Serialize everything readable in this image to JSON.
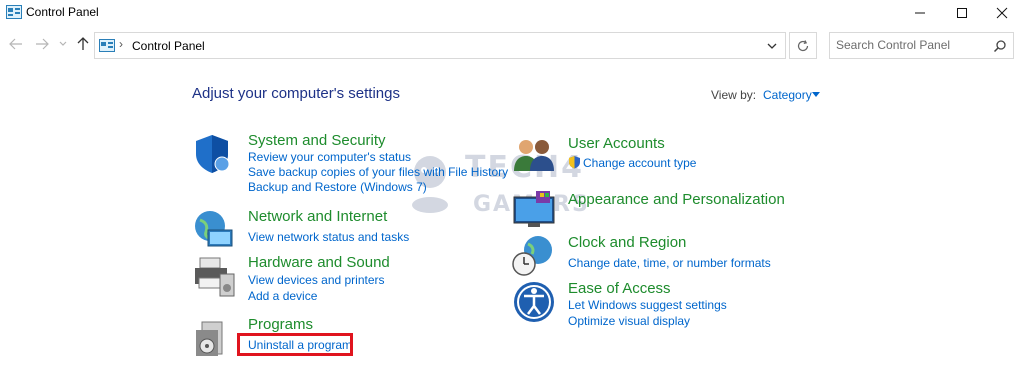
{
  "window": {
    "title": "Control Panel",
    "controls": {
      "minimize": "minimize-icon",
      "maximize": "maximize-icon",
      "close": "close-icon"
    }
  },
  "nav": {
    "back": "back-arrow-icon",
    "forward": "forward-arrow-icon",
    "recent": "chevron-down-icon",
    "up": "up-arrow-icon",
    "address": {
      "separator": "›",
      "location": "Control Panel"
    },
    "refresh": "refresh-icon",
    "search": {
      "placeholder": "Search Control Panel",
      "value": ""
    }
  },
  "content": {
    "heading": "Adjust your computer's settings",
    "view_by": {
      "label": "View by:",
      "value": "Category"
    },
    "categories_left": [
      {
        "title": "System and Security",
        "icon": "shield-icon",
        "links": [
          "Review your computer's status",
          "Save backup copies of your files with File History",
          "Backup and Restore (Windows 7)"
        ]
      },
      {
        "title": "Network and Internet",
        "icon": "network-globe-icon",
        "links": [
          "View network status and tasks"
        ]
      },
      {
        "title": "Hardware and Sound",
        "icon": "printer-icon",
        "links": [
          "View devices and printers",
          "Add a device"
        ]
      },
      {
        "title": "Programs",
        "icon": "programs-icon",
        "links": [
          "Uninstall a program"
        ]
      }
    ],
    "categories_right": [
      {
        "title": "User Accounts",
        "icon": "users-icon",
        "links": [
          "Change account type"
        ]
      },
      {
        "title": "Appearance and Personalization",
        "icon": "display-icon",
        "links": []
      },
      {
        "title": "Clock and Region",
        "icon": "clock-globe-icon",
        "links": [
          "Change date, time, or number formats"
        ]
      },
      {
        "title": "Ease of Access",
        "icon": "ease-of-access-icon",
        "links": [
          "Let Windows suggest settings",
          "Optimize visual display"
        ]
      }
    ]
  },
  "watermark": {
    "line1": "TECH4",
    "line2": "GAMERS"
  },
  "colors": {
    "link": "#0066cc",
    "category": "#1e8c2d",
    "heading": "#1e3287",
    "highlight": "#e0141e"
  }
}
